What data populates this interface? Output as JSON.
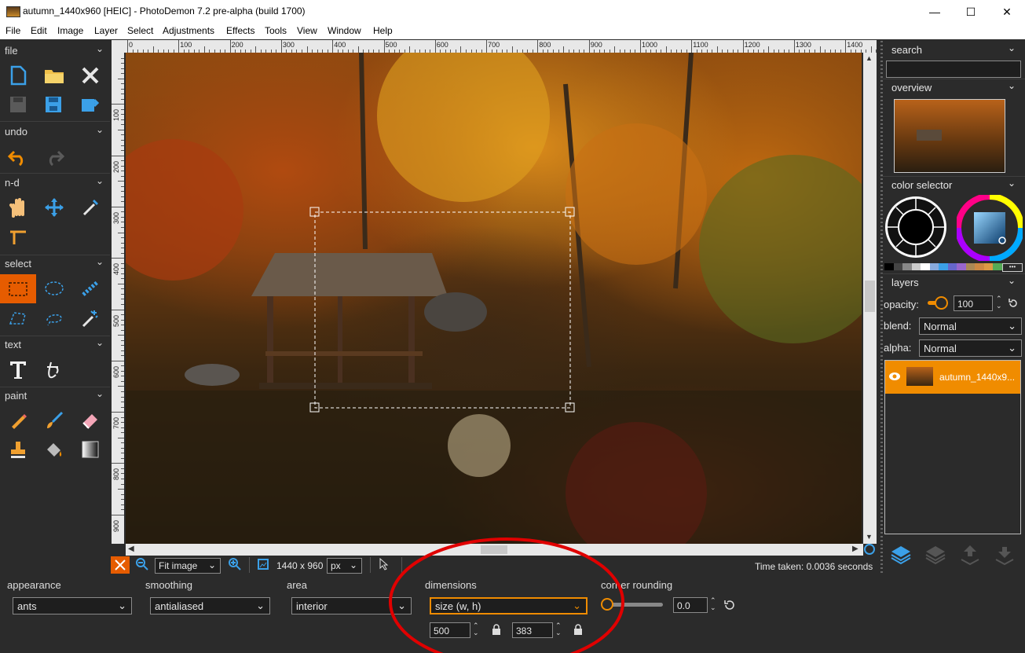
{
  "window": {
    "title": "autumn_1440x960 [HEIC]  -  PhotoDemon 7.2 pre-alpha (build 1700)",
    "minimize": "—",
    "maximize": "☐",
    "close": "✕"
  },
  "menu": [
    "File",
    "Edit",
    "Image",
    "Layer",
    "Select",
    "Adjustments",
    "Effects",
    "Tools",
    "View",
    "Window",
    "Help"
  ],
  "toolbox": {
    "sections": [
      {
        "label": "file",
        "chevron": "⌄"
      },
      {
        "label": "undo",
        "chevron": "⌄"
      },
      {
        "label": "n-d",
        "chevron": "⌄"
      },
      {
        "label": "select",
        "chevron": "⌄"
      },
      {
        "label": "text",
        "chevron": "⌄"
      },
      {
        "label": "paint",
        "chevron": "⌄"
      }
    ]
  },
  "ruler": {
    "top": [
      "0",
      "100",
      "200",
      "300",
      "400",
      "500",
      "600",
      "700",
      "800",
      "900",
      "1000",
      "1100",
      "1200",
      "1300",
      "1400"
    ],
    "left": [
      "100",
      "200",
      "300",
      "400",
      "500",
      "600",
      "700",
      "800",
      "900"
    ]
  },
  "statusbar": {
    "zoom": "Fit image",
    "dimensions": "1440 x 960",
    "unit": "px",
    "time_taken": "Time taken: 0.0036 seconds"
  },
  "options": {
    "appearance": {
      "label": "appearance",
      "value": "ants"
    },
    "smoothing": {
      "label": "smoothing",
      "value": "antialiased"
    },
    "area": {
      "label": "area",
      "value": "interior"
    },
    "dimensions": {
      "label": "dimensions",
      "value": "size (w, h)",
      "width": "500",
      "height": "383"
    },
    "corner_rounding": {
      "label": "corner rounding",
      "value": "0.0"
    }
  },
  "rightpanel": {
    "search": {
      "label": "search",
      "value": ""
    },
    "overview": {
      "label": "overview"
    },
    "color_selector": {
      "label": "color selector",
      "more": "•••"
    },
    "layers": {
      "label": "layers",
      "opacity_label": "opacity:",
      "opacity_value": "100",
      "blend_label": "blend:",
      "blend_value": "Normal",
      "alpha_label": "alpha:",
      "alpha_value": "Normal",
      "layer_name": "autumn_1440x9..."
    }
  },
  "colors": {
    "accent": "#e65c00",
    "panel": "#2b2b2b",
    "highlight": "#f08c00",
    "annotation": "#e00000"
  }
}
